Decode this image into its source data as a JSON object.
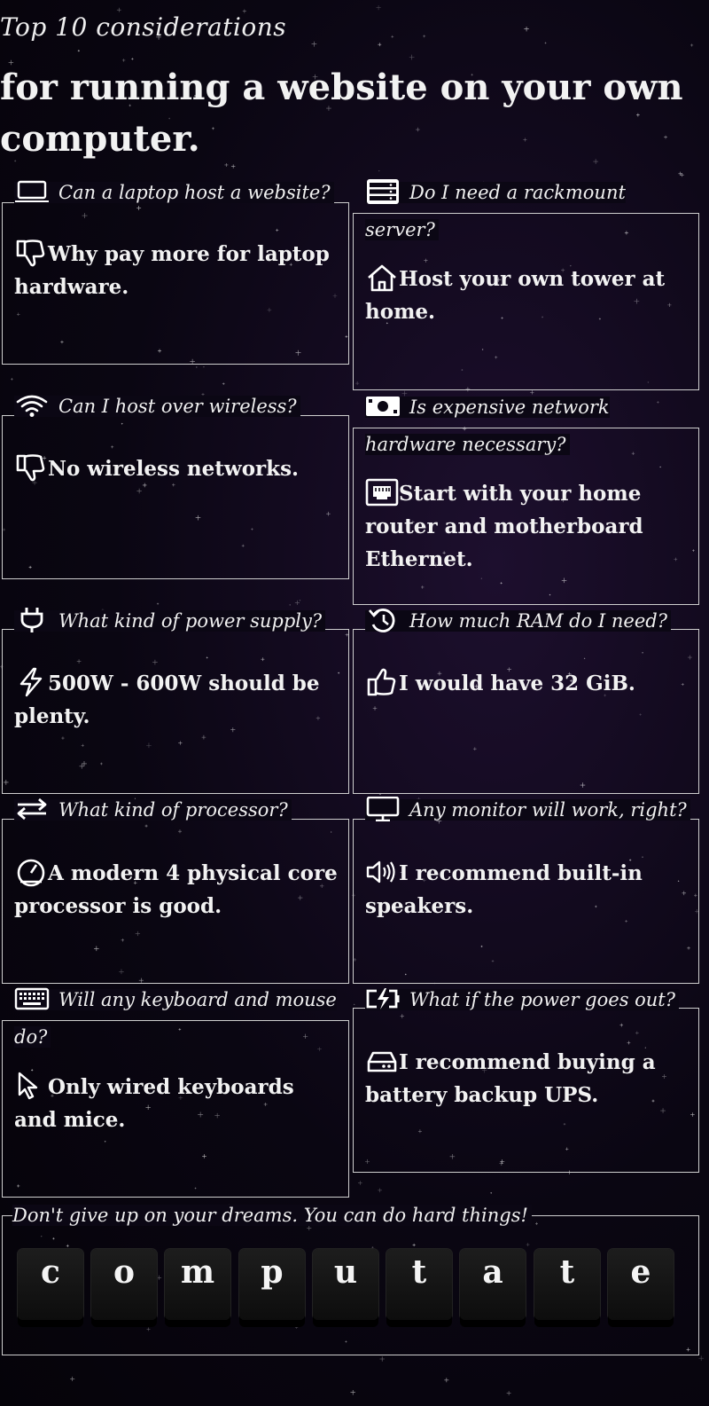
{
  "header": {
    "kicker": "Top 10 considerations",
    "headline": "for running a website on your own computer."
  },
  "cards": [
    {
      "question": "Can a laptop host a website?",
      "q_icon": "laptop-icon",
      "answer": "Why pay more for laptop hardware.",
      "a_icon": "thumbs-down-icon"
    },
    {
      "question": "Do I need a rackmount server?",
      "q_icon": "server-icon",
      "answer": "Host your own tower at home.",
      "a_icon": "home-icon"
    },
    {
      "question": "Can I host over wireless?",
      "q_icon": "wifi-icon",
      "answer": "No wireless networks.",
      "a_icon": "thumbs-down-icon"
    },
    {
      "question": "Is expensive network hardware necessary?",
      "q_icon": "money-icon",
      "answer": "Start with your home router and motherboard Ethernet.",
      "a_icon": "ethernet-port-icon"
    },
    {
      "question": "What kind of power supply?",
      "q_icon": "plug-icon",
      "answer": "500W - 600W should be plenty.",
      "a_icon": "lightning-icon"
    },
    {
      "question": "How much RAM do I need?",
      "q_icon": "history-icon",
      "answer": "I would have 32 GiB.",
      "a_icon": "thumbs-up-icon"
    },
    {
      "question": "What kind of processor?",
      "q_icon": "arrows-exchange-icon",
      "answer": "A modern 4 physical core processor is good.",
      "a_icon": "gauge-icon"
    },
    {
      "question": "Any monitor will work, right?",
      "q_icon": "monitor-icon",
      "answer": "I recommend built-in speakers.",
      "a_icon": "speaker-icon"
    },
    {
      "question": "Will any keyboard and mouse do?",
      "q_icon": "keyboard-icon",
      "answer": "Only wired keyboards and mice.",
      "a_icon": "cursor-icon"
    },
    {
      "question": "What if the power goes out?",
      "q_icon": "battery-charging-icon",
      "answer": "I recommend buying a battery backup UPS.",
      "a_icon": "hard-drive-icon"
    }
  ],
  "footer": {
    "label": "Don't give up on your dreams. You can do hard things!",
    "keys": [
      "c",
      "o",
      "m",
      "p",
      "u",
      "t",
      "a",
      "t",
      "e"
    ]
  }
}
